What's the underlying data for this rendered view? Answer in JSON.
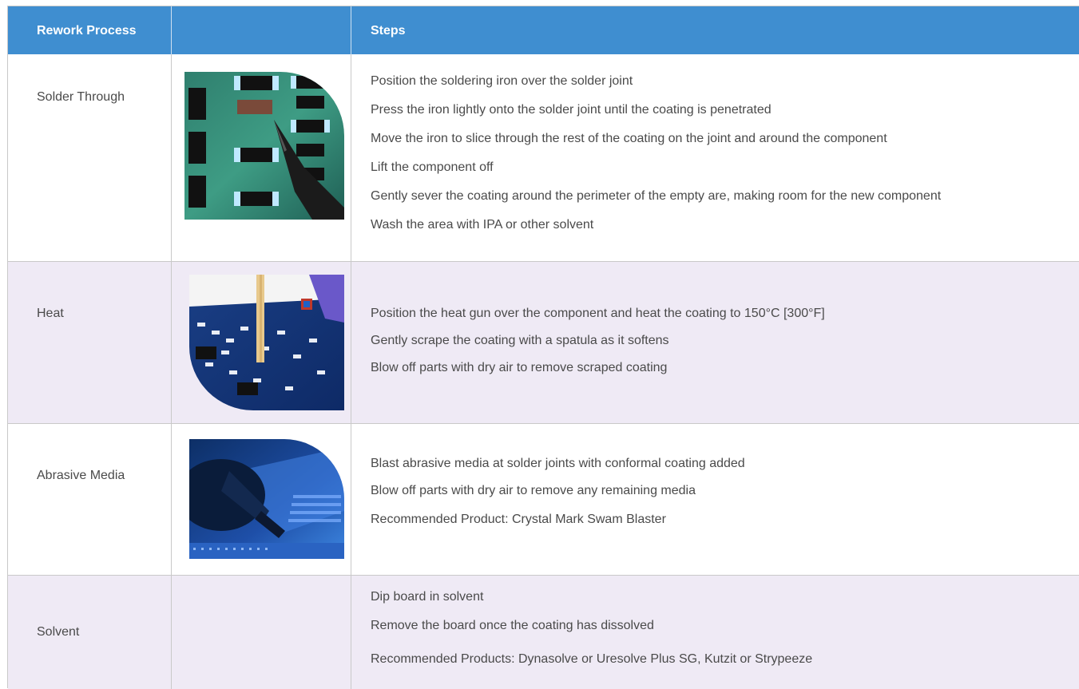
{
  "header": {
    "col_process": "Rework Process",
    "col_image": "",
    "col_steps": "Steps"
  },
  "rows": [
    {
      "process": "Solder Through",
      "image_icon": "pcb-soldering-iron-photo",
      "steps": [
        "Position the soldering iron over the solder joint",
        "Press the iron lightly onto the solder joint until the coating is penetrated",
        "Move the iron to slice through the rest of the coating on the joint and around the component",
        "Lift the component off",
        "Gently sever the coating around the perimeter of the empty are, making room for the new component",
        "Wash the area with IPA or other solvent"
      ]
    },
    {
      "process": "Heat",
      "image_icon": "pcb-spatula-photo",
      "steps": [
        "Position the heat gun over the component and heat the coating to 150°C [300°F]",
        "Gently scrape the coating with a spatula as it softens",
        "Blow off parts with dry air to remove scraped coating"
      ]
    },
    {
      "process": "Abrasive Media",
      "image_icon": "abrasive-blaster-photo",
      "steps": [
        "Blast abrasive media at solder joints with conformal coating added",
        "Blow off parts with dry air to remove any remaining media"
      ],
      "recommendation": "Recommended Product: Crystal Mark Swam Blaster"
    },
    {
      "process": "Solvent",
      "steps": [
        "Dip board in solvent",
        "Remove the board once the coating has dissolved"
      ],
      "recommendation": "Recommended Products: Dynasolve or Uresolve Plus SG, Kutzit or Strypeeze"
    }
  ],
  "colors": {
    "header_bg": "#3f8ed0",
    "alt_row_bg": "#efeaf5",
    "border": "#c9c9c9",
    "text": "#4a4a4a"
  }
}
